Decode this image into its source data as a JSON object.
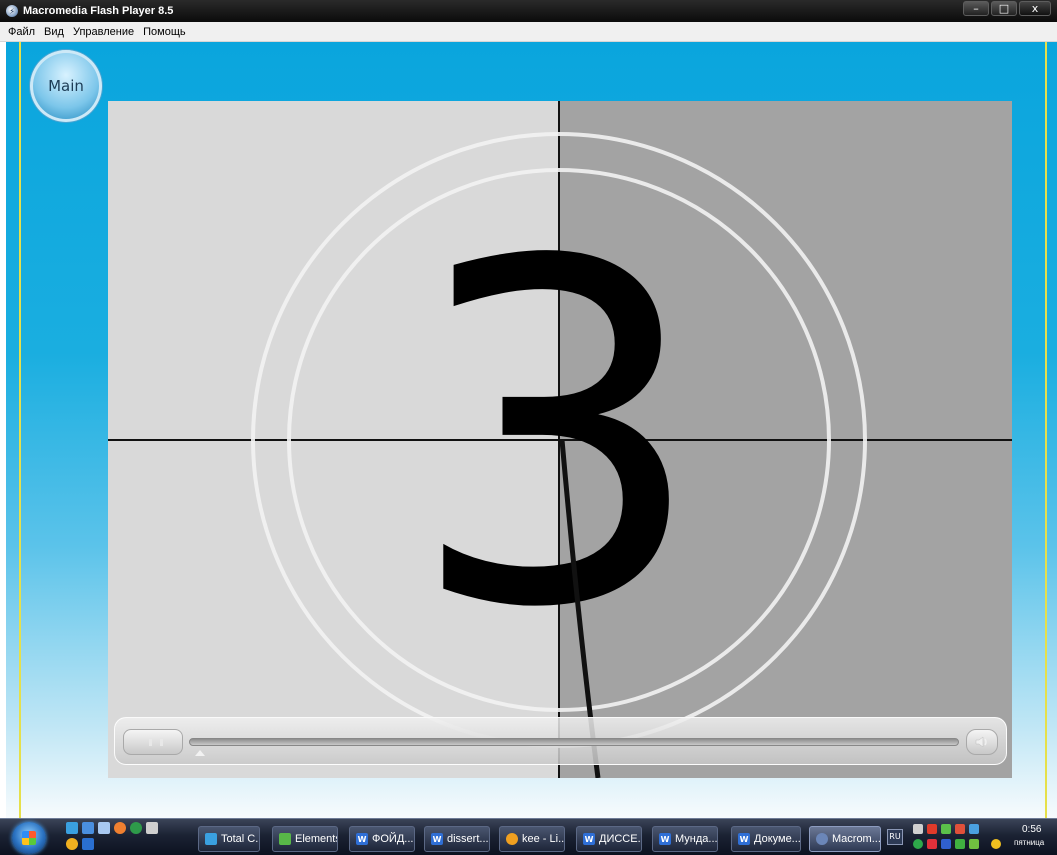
{
  "window": {
    "title": "Macromedia Flash Player 8.5",
    "minimize_glyph": "–",
    "maximize_glyph": "□",
    "close_glyph": "x"
  },
  "menu": {
    "items": [
      {
        "label": "Файл"
      },
      {
        "label": "Вид"
      },
      {
        "label": "Управление"
      },
      {
        "label": "Помощь"
      }
    ]
  },
  "stage": {
    "main_button_label": "Main",
    "countdown_digit": "3",
    "colors": {
      "left_panel": "#d9d9d9",
      "right_panel": "#a3a3a3",
      "background": "#0aa5dd",
      "guide_line": "#e6e04a"
    }
  },
  "controls": {
    "play_button": "pause-icon",
    "volume_button": "speaker-icon"
  },
  "taskbar": {
    "start_icon": "windows-logo-icon",
    "language": "RU",
    "tasks": [
      {
        "label": "Total C...",
        "icon": "total-commander-icon",
        "color": "#3aa0e0"
      },
      {
        "label": "Elements",
        "icon": "elements-icon",
        "color": "#58b848"
      },
      {
        "label": "ФОЙД...",
        "icon": "word-icon",
        "color": "#2f6fd6"
      },
      {
        "label": "dissert...",
        "icon": "word-icon",
        "color": "#2f6fd6"
      },
      {
        "label": "kee - Li...",
        "icon": "browser-icon",
        "color": "#f0a020"
      },
      {
        "label": "ДИССЕ...",
        "icon": "word-icon",
        "color": "#2f6fd6"
      },
      {
        "label": "Мунда...",
        "icon": "word-icon",
        "color": "#2f6fd6"
      },
      {
        "label": "Докуме...",
        "icon": "word-icon",
        "color": "#2f6fd6"
      },
      {
        "label": "Macrom...",
        "icon": "flash-player-icon",
        "color": "#6b86b8"
      }
    ],
    "clock": {
      "time": "0:56",
      "day": "пятница"
    }
  }
}
